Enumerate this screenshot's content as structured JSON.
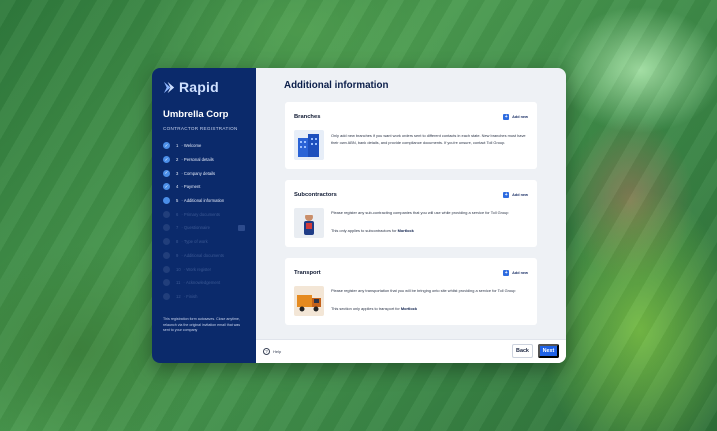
{
  "brand": {
    "name": "Rapid"
  },
  "sidebar": {
    "company": "Umbrella Corp",
    "section_label": "CONTRACTOR REGISTRATION",
    "steps": [
      {
        "num": "1",
        "label": "Welcome",
        "state": "done"
      },
      {
        "num": "2",
        "label": "Personal details",
        "state": "done"
      },
      {
        "num": "3",
        "label": "Company details",
        "state": "done"
      },
      {
        "num": "4",
        "label": "Payment",
        "state": "done"
      },
      {
        "num": "5",
        "label": "Additional information",
        "state": "current"
      },
      {
        "num": "6",
        "label": "Primary documents",
        "state": "pending"
      },
      {
        "num": "7",
        "label": "Questionnaire",
        "state": "pending"
      },
      {
        "num": "8",
        "label": "Type of work",
        "state": "pending"
      },
      {
        "num": "9",
        "label": "Additional documents",
        "state": "pending"
      },
      {
        "num": "10",
        "label": "Work register",
        "state": "pending"
      },
      {
        "num": "11",
        "label": "Acknowledgement",
        "state": "pending"
      },
      {
        "num": "12",
        "label": "Finish",
        "state": "pending"
      }
    ],
    "note": "This registration form autosaves. Close anytime, relaunch via the original invitation email that was sent to your company"
  },
  "main": {
    "title": "Additional information",
    "add_new_label": "Add new",
    "cards": {
      "branches": {
        "title": "Branches",
        "text": "Only add new branches if you want work orders sent to different contacts in each state. New branches must have their own ABN, bank details, and provide compliance documents. If you're unsure, contact Toll Group."
      },
      "subcontractors": {
        "title": "Subcontractors",
        "text": "Please register any sub-contracting companies that you will use while providing a service for Toll Group",
        "note_prefix": "This only applies to subcontractors for",
        "note_bold": "Mortlock"
      },
      "transport": {
        "title": "Transport",
        "text": "Please register any transportation that you will be bringing onto site whilst providing a service for Toll Group",
        "note_prefix": "This section only applies to transport for",
        "note_bold": "Mortlock"
      }
    }
  },
  "footer": {
    "help_label": "Help",
    "back_label": "Back",
    "next_label": "Next"
  },
  "colors": {
    "sidebar_bg": "#0b2a6b",
    "accent": "#1f62e6",
    "step_done": "#4b8ee8"
  }
}
